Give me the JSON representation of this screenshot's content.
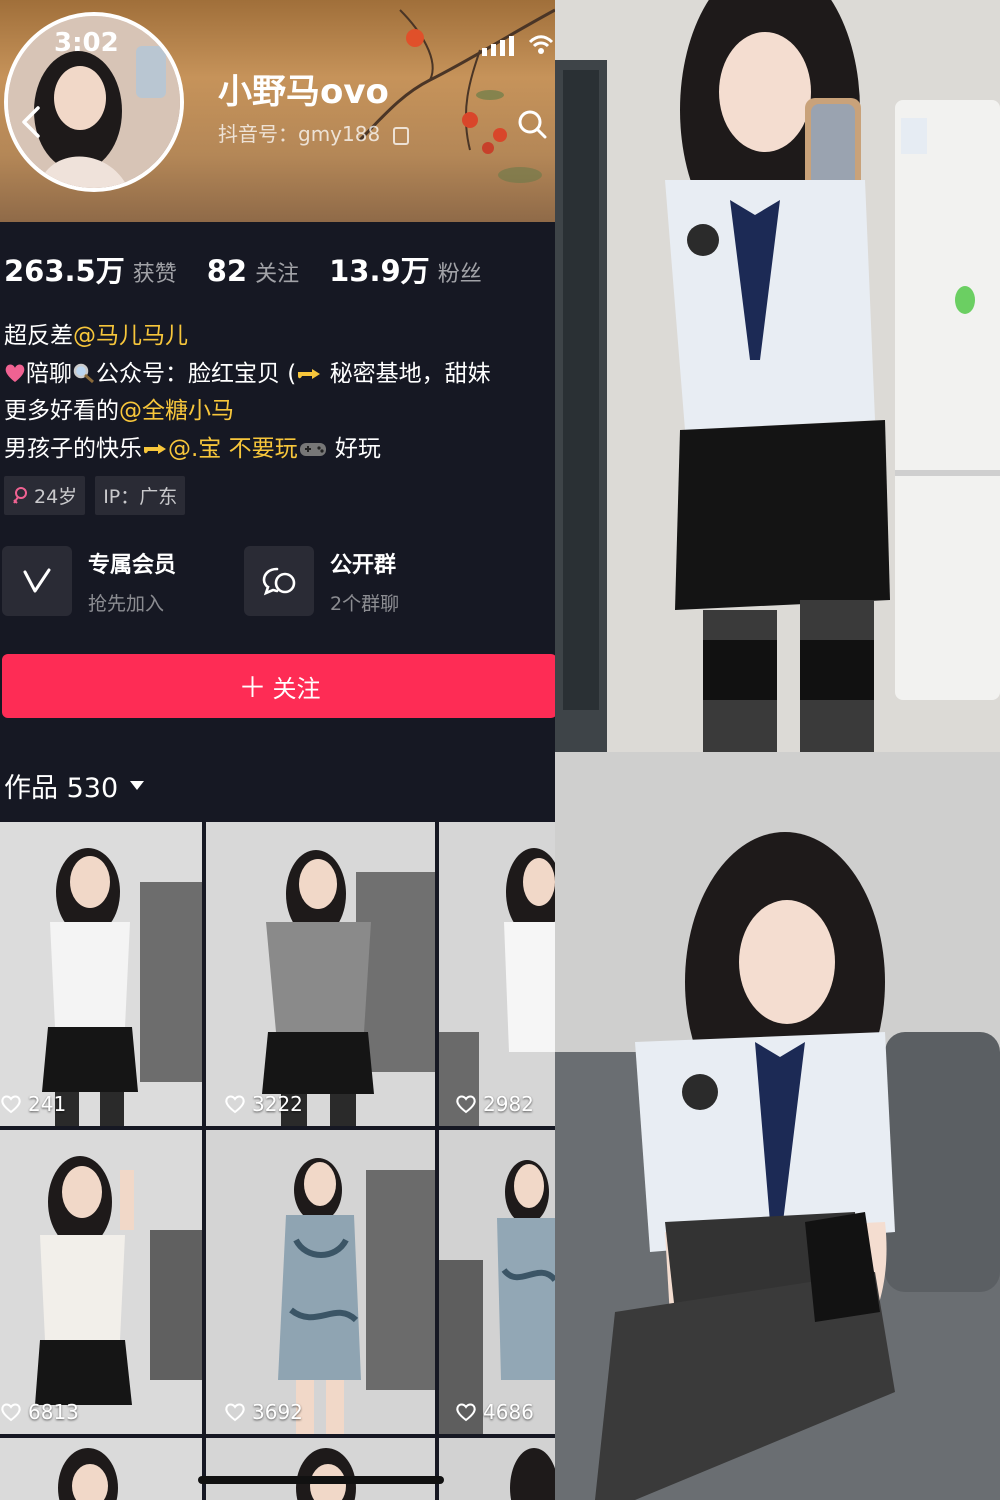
{
  "status": {
    "time": "3:02"
  },
  "profile": {
    "name": "小野马ovo",
    "douyin_id": "抖音号：gmy188"
  },
  "stats": [
    {
      "value": "263.5万",
      "label": "获赞"
    },
    {
      "value": "82",
      "label": "关注"
    },
    {
      "value": "13.9万",
      "label": "粉丝"
    }
  ],
  "bio": {
    "line1_text": "超反差",
    "line1_mention": "@马儿马儿",
    "line2_a": "陪聊",
    "line2_b": "公众号：脸红宝贝 (",
    "line2_c": " 秘密基地，甜妹",
    "line3_text": "更多好看的",
    "line3_mention": "@全糖小马",
    "line4_text": "男孩子的快乐",
    "line4_mention": "@.宝 不要玩",
    "line4_end": " 好玩"
  },
  "tags": {
    "age": "24岁",
    "ip": "IP：广东"
  },
  "features": [
    {
      "title": "专属会员",
      "sub": "抢先加入"
    },
    {
      "title": "公开群",
      "sub": "2个群聊"
    }
  ],
  "follow_button": {
    "label": "关注"
  },
  "works": {
    "label": "作品 530"
  },
  "grid": [
    {
      "likes": "241"
    },
    {
      "likes": "3222"
    },
    {
      "likes": "2982"
    },
    {
      "likes": "6813"
    },
    {
      "likes": "3692"
    },
    {
      "likes": "4686"
    }
  ],
  "colors": {
    "accent": "#fe2c55",
    "mention": "#f7c63b",
    "background": "#161823"
  },
  "icons": [
    "back-icon",
    "search-icon",
    "signal-icon",
    "wifi-icon",
    "copy-icon",
    "female-icon",
    "vip-icon",
    "group-chat-icon",
    "heart-icon",
    "caret-down-icon"
  ]
}
